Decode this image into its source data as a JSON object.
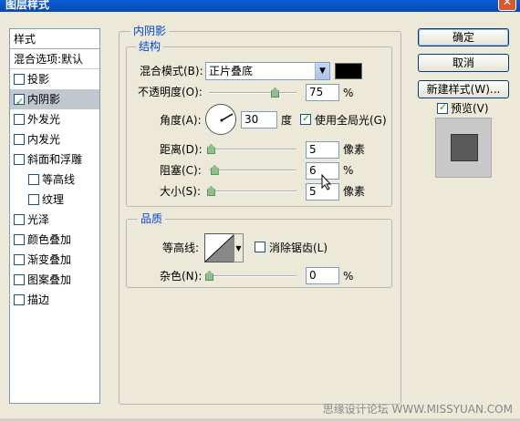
{
  "window": {
    "title": "图层样式",
    "close": "✕"
  },
  "left_panel": {
    "header": "样式",
    "blend": "混合选项:默认",
    "items": [
      {
        "label": "投影",
        "checked": false,
        "sub": false
      },
      {
        "label": "内阴影",
        "checked": true,
        "sub": false,
        "selected": true
      },
      {
        "label": "外发光",
        "checked": false,
        "sub": false
      },
      {
        "label": "内发光",
        "checked": false,
        "sub": false
      },
      {
        "label": "斜面和浮雕",
        "checked": false,
        "sub": false
      },
      {
        "label": "等高线",
        "checked": false,
        "sub": true
      },
      {
        "label": "纹理",
        "checked": false,
        "sub": true
      },
      {
        "label": "光泽",
        "checked": false,
        "sub": false
      },
      {
        "label": "颜色叠加",
        "checked": false,
        "sub": false
      },
      {
        "label": "渐变叠加",
        "checked": false,
        "sub": false
      },
      {
        "label": "图案叠加",
        "checked": false,
        "sub": false
      },
      {
        "label": "描边",
        "checked": false,
        "sub": false
      }
    ]
  },
  "inner_shadow": {
    "section_title": "内阴影",
    "structure_title": "结构",
    "blend_mode_label": "混合模式(B):",
    "blend_mode_value": "正片叠底",
    "opacity_label": "不透明度(O):",
    "opacity_value": "75",
    "opacity_level_pct": 75,
    "percent": "%",
    "angle_label": "角度(A):",
    "angle_value": "30",
    "degree": "度",
    "global_light_label": "使用全局光(G)",
    "global_light_checked": true,
    "distance_label": "距离(D):",
    "distance_value": "5",
    "distance_level_pct": 2,
    "pixels": "像素",
    "choke_label": "阻塞(C):",
    "choke_value": "6",
    "choke_level_pct": 6,
    "size_label": "大小(S):",
    "size_value": "5",
    "size_level_pct": 2,
    "color": "#000000"
  },
  "quality": {
    "title": "品质",
    "contour_label": "等高线:",
    "antialias_label": "消除锯齿(L)",
    "antialias_checked": false,
    "noise_label": "杂色(N):",
    "noise_value": "0",
    "noise_level_pct": 0,
    "percent": "%"
  },
  "buttons": {
    "ok": "确定",
    "cancel": "取消",
    "new_style": "新建样式(W)...",
    "preview_label": "预览(V)",
    "preview_checked": true
  },
  "watermark": "思缘设计论坛 WWW.MISSYUAN.COM"
}
